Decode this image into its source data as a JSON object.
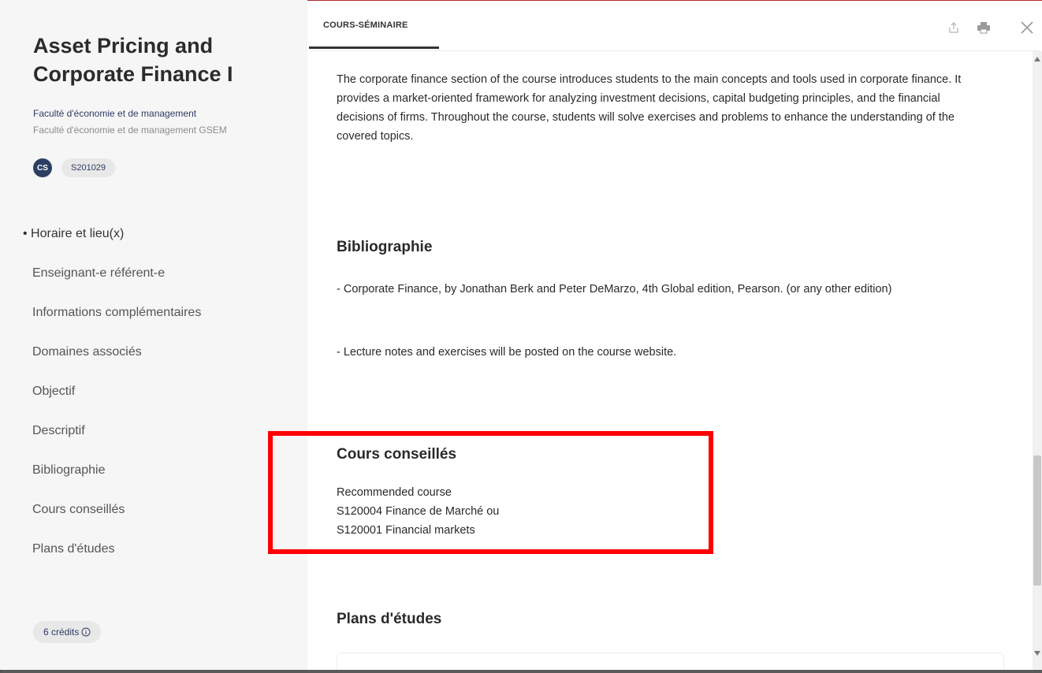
{
  "sidebar": {
    "title": "Asset Pricing and Corporate Finance I",
    "faculty": "Faculté d'économie et de management",
    "faculty_sub": "Faculté d'économie et de management GSEM",
    "badge": "CS",
    "course_code": "S201029",
    "toc": [
      {
        "label": "• Horaire et lieu(x)"
      },
      {
        "label": "Enseignant-e référent-e"
      },
      {
        "label": "Informations complémentaires"
      },
      {
        "label": "Domaines associés"
      },
      {
        "label": "Objectif"
      },
      {
        "label": "Descriptif"
      },
      {
        "label": "Bibliographie"
      },
      {
        "label": "Cours conseillés"
      },
      {
        "label": "Plans d'études"
      }
    ],
    "credits": "6 crédits",
    "credits_icon": "info-icon"
  },
  "header": {
    "tab_label": "COURS-SÉMINAIRE",
    "icons": [
      "share-icon",
      "print-icon",
      "close-icon"
    ]
  },
  "content": {
    "intro_paragraph": "The corporate finance section of the course introduces students to the main concepts and tools used in corporate finance. It provides a market-oriented framework for analyzing investment decisions, capital budgeting principles, and the financial decisions of firms. Throughout the course, students will solve exercises and problems to enhance the understanding of the covered topics.",
    "bibliography_heading": "Bibliographie",
    "bibliography_item1": "- Corporate Finance, by Jonathan Berk and Peter DeMarzo, 4th Global edition, Pearson. (or any other edition)",
    "bibliography_item2": "- Lecture notes and exercises will be posted on the course website.",
    "recommended_heading": "Cours conseillés",
    "recommended_lines": [
      "Recommended course",
      "S120004 Finance de Marché ou",
      "S120001 Financial markets"
    ],
    "plans_heading": "Plans d'études"
  },
  "colors": {
    "highlight": "#ff0000",
    "accent": "#2c3f63"
  }
}
